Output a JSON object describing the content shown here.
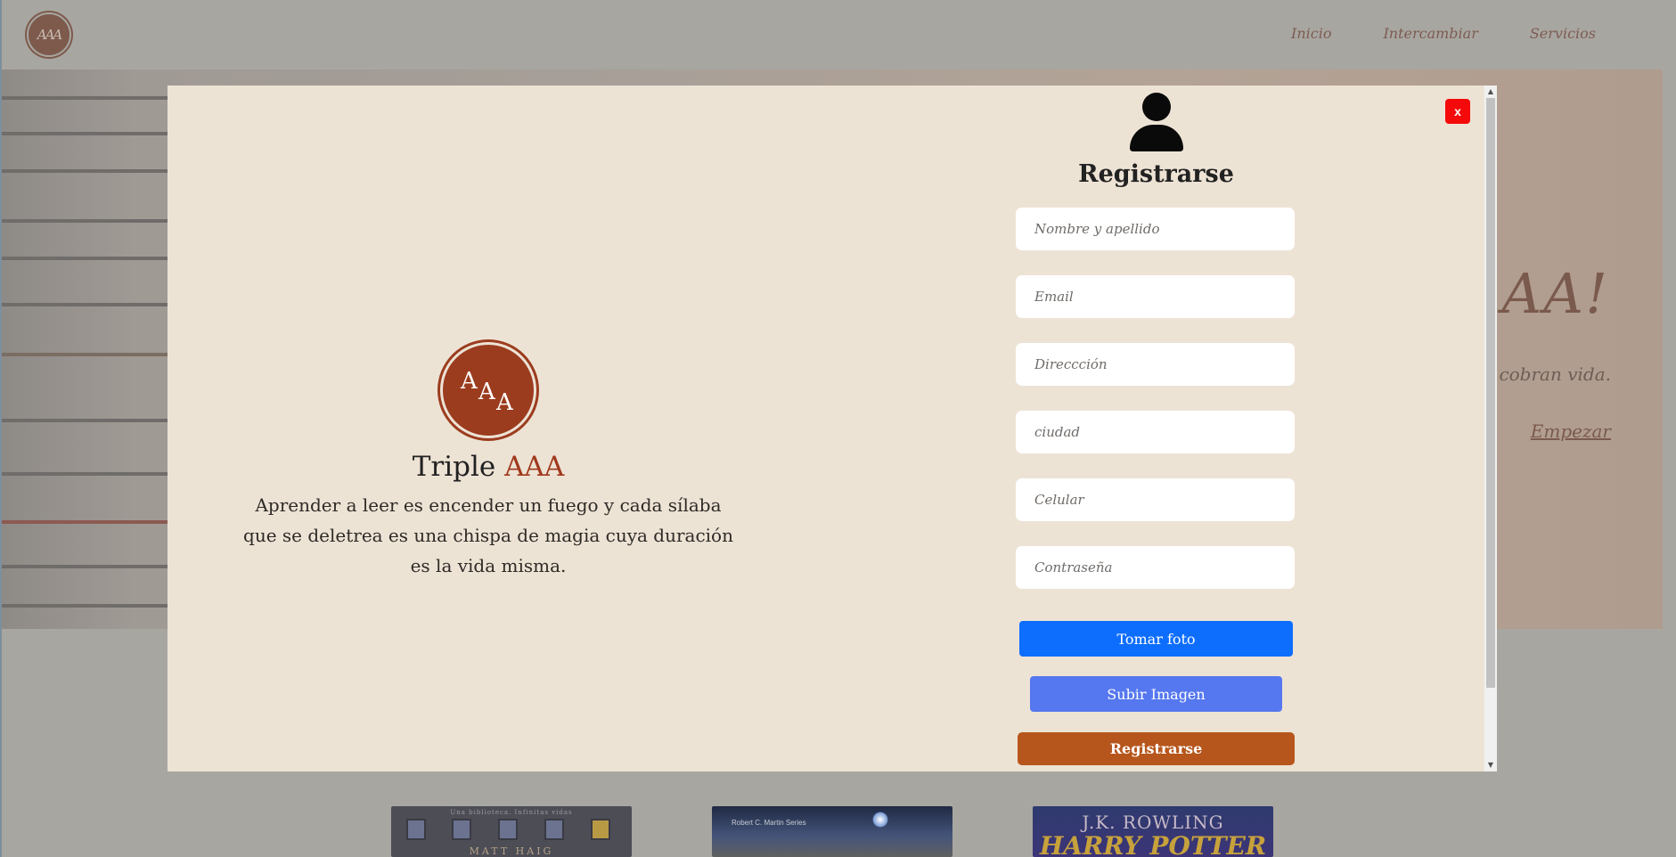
{
  "navbar": {
    "logo_text": "AAA",
    "links": [
      "Inicio",
      "Intercambiar",
      "Servicios"
    ]
  },
  "hero": {
    "title_partial": "AAA!",
    "subtitle_partial": "ias cobran vida.",
    "cta": "Empezar"
  },
  "books": [
    {
      "top_text": "Una biblioteca. Infinitas vidas",
      "author": "MATT HAIG"
    },
    {
      "series": "Robert C. Martin Series"
    },
    {
      "author": "J.K. ROWLING",
      "title": "HARRY POTTER"
    }
  ],
  "modal": {
    "close_label": "x",
    "brand": {
      "logo_letters": [
        "A",
        "A",
        "A"
      ],
      "name_prefix": "Triple",
      "name_accent": "AAA",
      "quote": "Aprender a leer es encender un fuego y cada sílaba que se deletrea es una chispa de magia cuya duración es la vida misma."
    },
    "form": {
      "title": "Registrarse",
      "fields": [
        {
          "placeholder": "Nombre y apellido",
          "value": ""
        },
        {
          "placeholder": "Email",
          "value": ""
        },
        {
          "placeholder": "Direccción",
          "value": ""
        },
        {
          "placeholder": "ciudad",
          "value": ""
        },
        {
          "placeholder": "Celular",
          "value": ""
        },
        {
          "placeholder": "Contraseña",
          "value": ""
        }
      ],
      "photo_button": "Tomar foto",
      "upload_button": "Subir Imagen",
      "submit_button": "Registrarse"
    }
  },
  "colors": {
    "accent_brand": "#9b3c1e",
    "modal_bg": "#ede3d5",
    "photo_button": "#0d6efd",
    "upload_button": "#5577ef",
    "submit_button": "#b7561c",
    "close_button": "#f40a0a"
  }
}
